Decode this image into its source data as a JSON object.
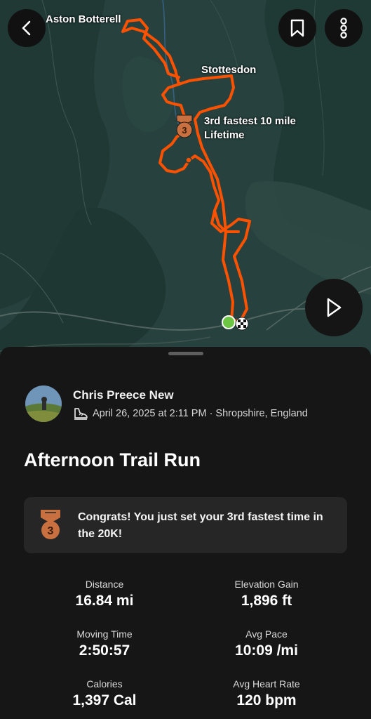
{
  "map": {
    "place_labels": [
      "Aston Botterell",
      "Stottesdon"
    ],
    "achievement_label_line1": "3rd fastest 10 mile",
    "achievement_label_line2": "Lifetime",
    "medal_rank": "3",
    "route_color": "#fc5200",
    "start_marker_color": "#6cc644"
  },
  "toolbar": {
    "back": "back",
    "save": "bookmark",
    "more": "more",
    "play": "play"
  },
  "athlete": {
    "name": "Chris Preece New",
    "date": "April 26, 2025 at 2:11 PM · Shropshire, England"
  },
  "activity": {
    "title": "Afternoon Trail Run"
  },
  "achievement": {
    "rank": "3",
    "text": "Congrats! You just set your 3rd fastest time in the 20K!",
    "color": "#c8703f"
  },
  "stats": [
    {
      "label": "Distance",
      "value": "16.84 mi"
    },
    {
      "label": "Elevation Gain",
      "value": "1,896 ft"
    },
    {
      "label": "Moving Time",
      "value": "2:50:57"
    },
    {
      "label": "Avg Pace",
      "value": "10:09 /mi"
    },
    {
      "label": "Calories",
      "value": "1,397 Cal"
    },
    {
      "label": "Avg Heart Rate",
      "value": "120 bpm"
    }
  ]
}
